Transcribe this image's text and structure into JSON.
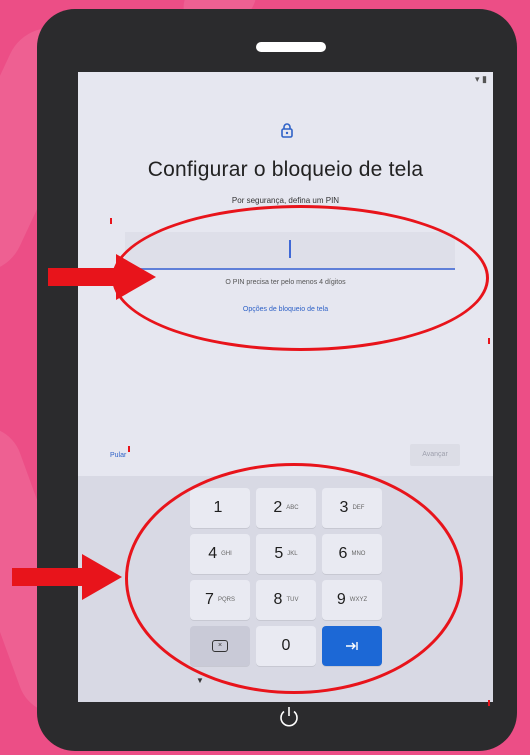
{
  "screen": {
    "title": "Configurar o bloqueio de tela",
    "subtitle": "Por segurança, defina um PIN",
    "pin_value": "",
    "pin_helper": "O PIN precisa ter pelo menos 4 dígitos",
    "options_link": "Opções de bloqueio de tela",
    "skip_label": "Pular",
    "next_label": "Avançar",
    "status_icons": "▾ ▮"
  },
  "keypad": {
    "rows": [
      [
        {
          "digit": "1",
          "letters": ""
        },
        {
          "digit": "2",
          "letters": "ABC"
        },
        {
          "digit": "3",
          "letters": "DEF"
        }
      ],
      [
        {
          "digit": "4",
          "letters": "GHI"
        },
        {
          "digit": "5",
          "letters": "JKL"
        },
        {
          "digit": "6",
          "letters": "MNO"
        }
      ],
      [
        {
          "digit": "7",
          "letters": "PQRS"
        },
        {
          "digit": "8",
          "letters": "TUV"
        },
        {
          "digit": "9",
          "letters": "WXYZ"
        }
      ]
    ],
    "zero": "0",
    "backspace_glyph": "⌫",
    "enter_glyph": "⇥"
  },
  "colors": {
    "background": "#ec4e86",
    "device": "#2b2b2d",
    "accent_blue": "#1c68d6",
    "annotation_red": "#e8141b"
  },
  "icons": {
    "lock": "lock-icon",
    "power": "power-icon",
    "arrow": "right-arrow-icon",
    "backspace": "backspace-icon",
    "enter": "enter-icon"
  }
}
